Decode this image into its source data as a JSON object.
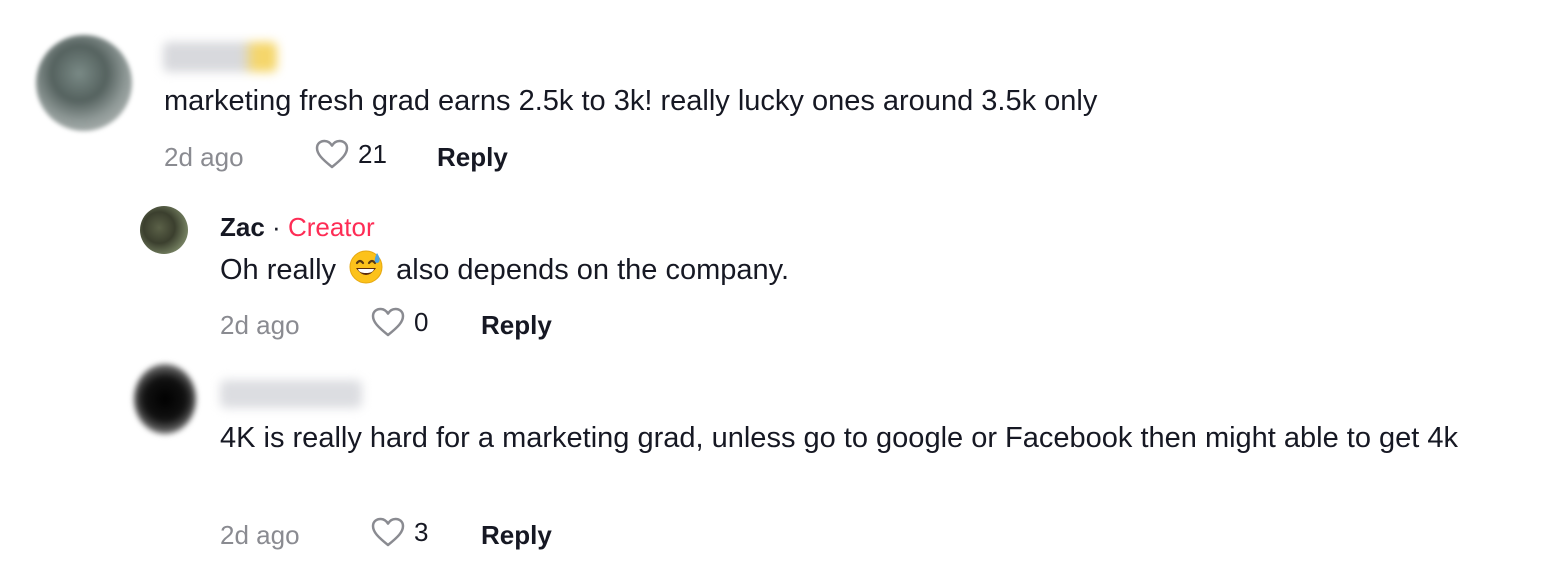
{
  "comments": [
    {
      "username": "",
      "text": "marketing fresh grad earns 2.5k to 3k! really lucky ones around 3.5k only",
      "time": "2d ago",
      "likes": "21",
      "reply_label": "Reply"
    },
    {
      "username": "Zac",
      "separator": "·",
      "badge": "Creator",
      "text_before": "Oh really",
      "emoji": "grinning-face-with-sweat-icon",
      "text_after": "also depends on the company.",
      "time": "2d ago",
      "likes": "0",
      "reply_label": "Reply"
    },
    {
      "username": "",
      "text": "4K is really hard for a marketing grad, unless go to google or Facebook then might able to get 4k",
      "time": "2d ago",
      "likes": "3",
      "reply_label": "Reply"
    }
  ],
  "colors": {
    "creator_badge": "#fe2c55",
    "meta_text": "#8a8b91",
    "primary_text": "#161823"
  }
}
